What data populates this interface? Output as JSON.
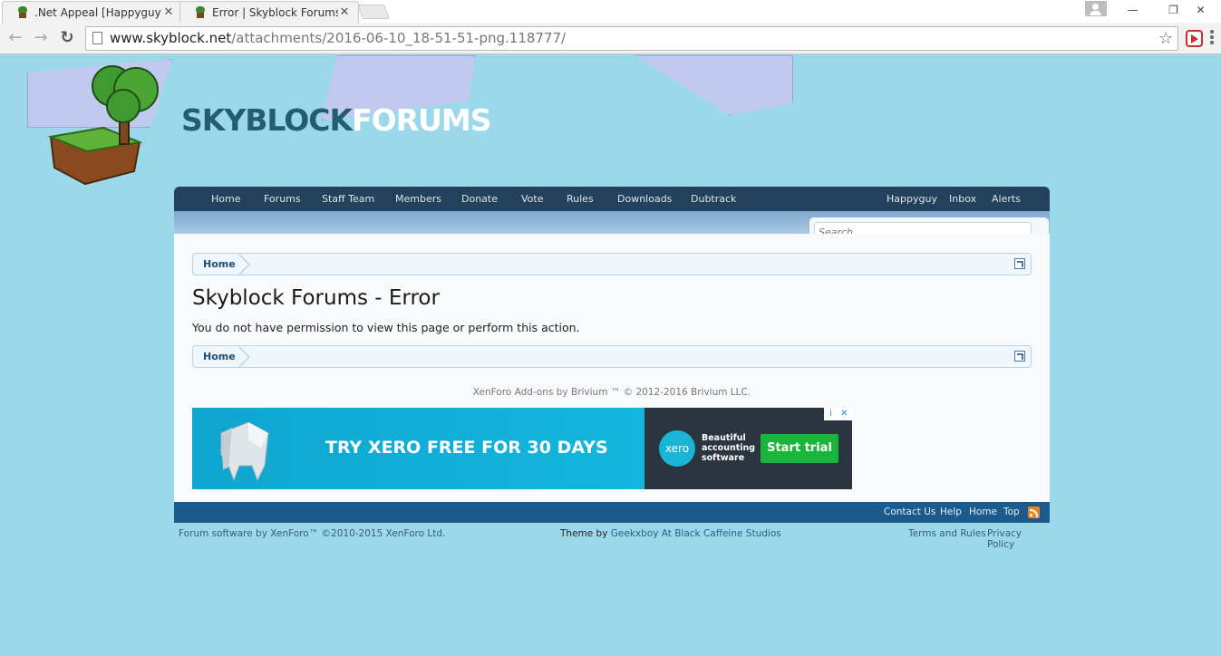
{
  "browser": {
    "tabs": [
      {
        "title": ".Net Appeal [Happyguy] [",
        "close": "✕"
      },
      {
        "title": "Error | Skyblock Forums",
        "close": "✕"
      }
    ],
    "url_host": "www.skyblock.net",
    "url_path": "/attachments/2016-06-10_18-51-51-png.118777/",
    "window_controls": {
      "minimize": "—",
      "maximize": "❐",
      "close": "✕"
    },
    "icons": {
      "back": "arrow-left-icon",
      "forward": "arrow-right-icon",
      "reload": "reload-icon",
      "star": "star-icon"
    }
  },
  "logo": {
    "word1": "SKYBLOCK",
    "word2": "FORUMS"
  },
  "nav": {
    "left": [
      "Home",
      "Forums",
      "Staff Team",
      "Members",
      "Donate",
      "Vote",
      "Rules",
      "Downloads",
      "Dubtrack"
    ],
    "right": [
      "Happyguy",
      "Inbox",
      "Alerts"
    ]
  },
  "search": {
    "placeholder": "Search..."
  },
  "breadcrumb": {
    "home": "Home"
  },
  "main": {
    "title": "Skyblock Forums - Error",
    "message": "You do not have permission to view this page or perform this action."
  },
  "addon_copyright": "XenForo Add-ons by Brivium ™ © 2012-2016 Brivium LLC.",
  "ad": {
    "headline": "TRY XERO FREE FOR 30 DAYS",
    "logo_text": "xero",
    "tagline": "Beautiful accounting software",
    "cta": "Start trial",
    "choices_info": "i",
    "choices_close": "✕"
  },
  "footer": {
    "links": [
      "Contact Us",
      "Help",
      "Home",
      "Top"
    ],
    "software": "Forum software by XenForo™ ©2010-2015 XenForo Ltd.",
    "theme_prefix": "Theme by ",
    "theme_link": "Geekxboy At Black Caffeine Studios",
    "legal": [
      "Terms and Rules",
      "Privacy Policy"
    ]
  },
  "colors": {
    "page_bg": "#9bd8e9",
    "navbar": "#23415a",
    "footer": "#1c5b8d",
    "ad_blue": "#16a9cf",
    "cta_green": "#1ab63c"
  }
}
